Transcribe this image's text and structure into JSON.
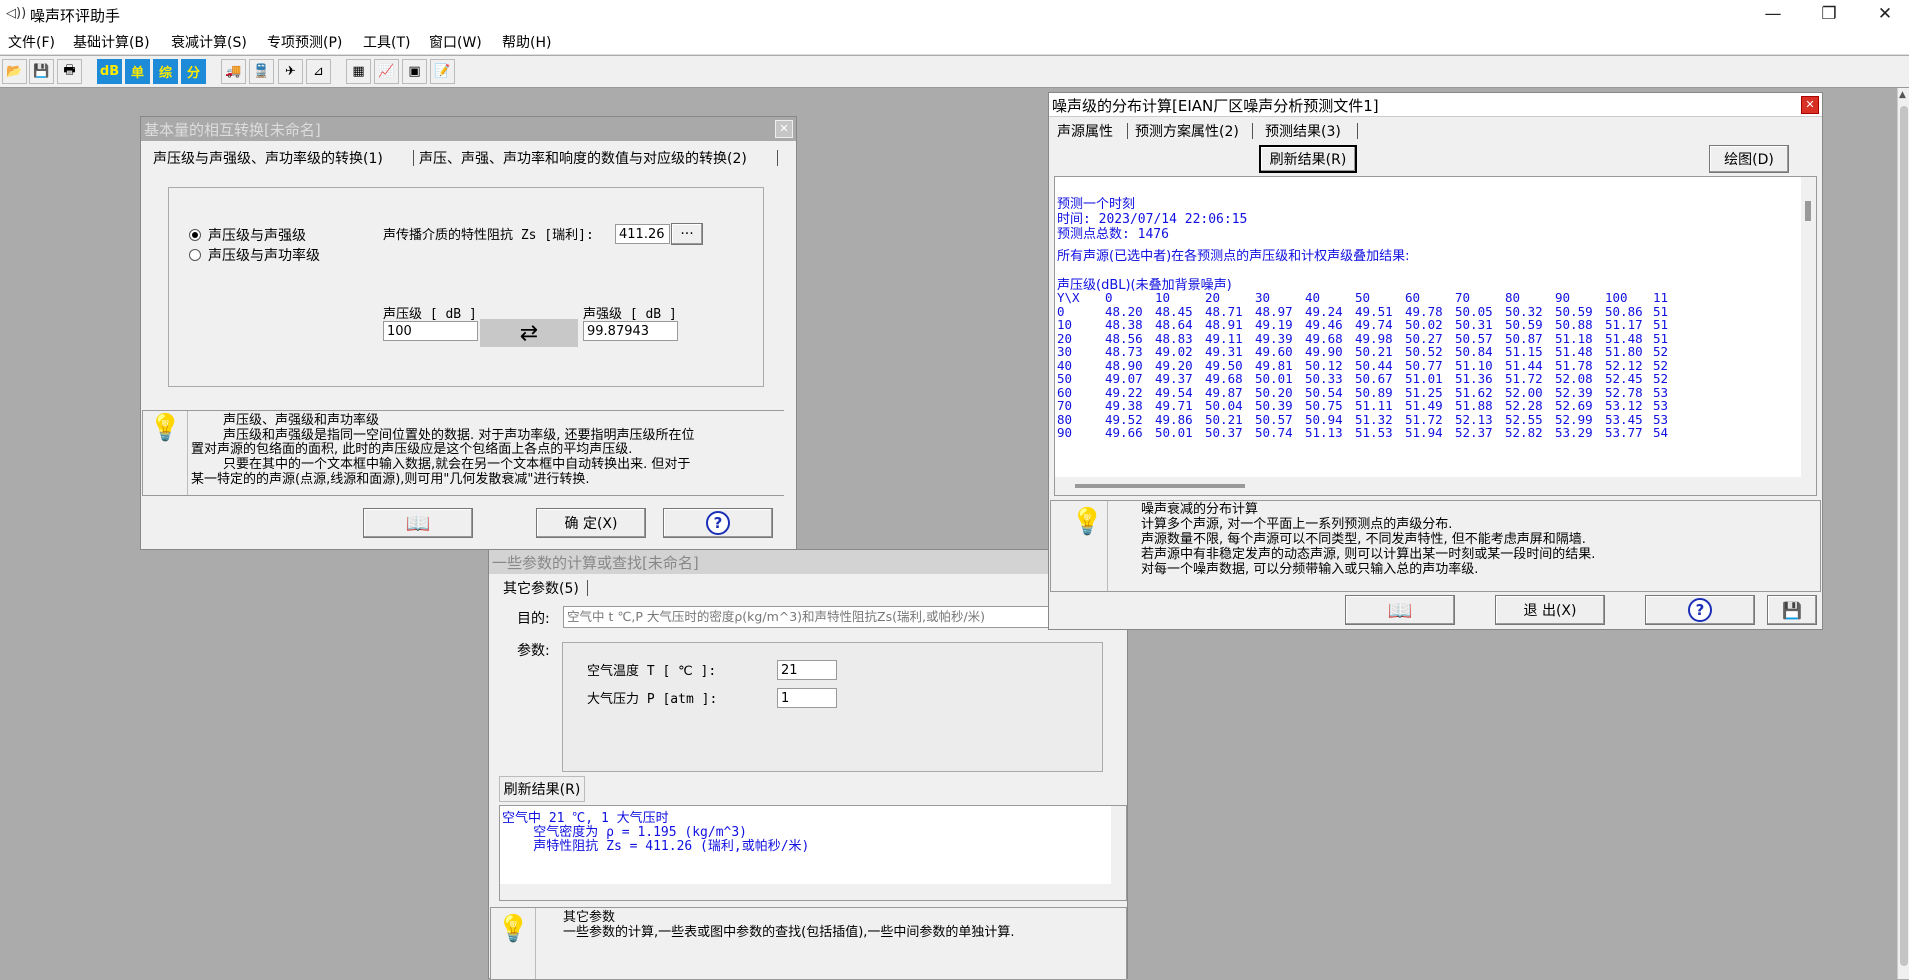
{
  "app": {
    "title": "噪声环评助手",
    "icon": "speaker-icon",
    "minimize": "—",
    "maximize": "❐",
    "close": "✕"
  },
  "menu": [
    "文件(F)",
    "基础计算(B)",
    "衰减计算(S)",
    "专项预测(P)",
    "工具(T)",
    "窗口(W)",
    "帮助(H)"
  ],
  "toolbar": {
    "db": "dB",
    "single": "单",
    "combined": "综",
    "split": "分"
  },
  "dlg1": {
    "title": "基本量的相互转换[未命名]",
    "tab1": "声压级与声强级、声功率级的转换(1)",
    "tab2": "声压、声强、声功率和响度的数值与对应级的转换(2)",
    "radio1": "声压级与声强级",
    "radio2": "声压级与声功率级",
    "impedance_label": "声传播介质的特性阻抗 Zs [瑞利]:",
    "impedance_value": "411.26",
    "impedance_btn": "···",
    "spl_label": "声压级 [ dB ]",
    "spl_value": "100",
    "sil_label": "声强级 [ dB ]",
    "sil_value": "99.87943",
    "help_lines": [
      "声压级、声强级和声功率级",
      "声压级和声强级是指同一空间位置处的数据. 对于声功率级, 还要指明声压级所在位",
      "置对声源的包络面的面积, 此时的声压级应是这个包络面上各点的平均声压级.",
      "只要在其中的一个文本框中输入数据,就会在另一个文本框中自动转换出来. 但对于",
      "某一特定的的声源(点源,线源和面源),则可用\"几何发散衰减\"进行转换."
    ],
    "ok": "确 定(X)"
  },
  "dlg2": {
    "title": "噪声级的分布计算[EIAN厂区噪声分析预测文件1]",
    "tabs": [
      "声源属性",
      "预测方案属性(2)",
      "预测结果(3)"
    ],
    "refresh": "刷新结果(R)",
    "plot": "绘图(D)",
    "res_line1": "预测一个时刻",
    "res_line2": "时间: 2023/07/14 22:06:15",
    "res_line3": "预测点总数: 1476",
    "res_line4": "所有声源(已选中者)在各预测点的声压级和计权声级叠加结果:",
    "res_line5": "声压级(dBL)(未叠加背景噪声)",
    "table_corner": "Y\\X",
    "table_cols": [
      "0",
      "10",
      "20",
      "30",
      "40",
      "50",
      "60",
      "70",
      "80",
      "90",
      "100",
      "11"
    ],
    "table_rows": [
      [
        "0",
        "48.20",
        "48.45",
        "48.71",
        "48.97",
        "49.24",
        "49.51",
        "49.78",
        "50.05",
        "50.32",
        "50.59",
        "50.86",
        "51"
      ],
      [
        "10",
        "48.38",
        "48.64",
        "48.91",
        "49.19",
        "49.46",
        "49.74",
        "50.02",
        "50.31",
        "50.59",
        "50.88",
        "51.17",
        "51"
      ],
      [
        "20",
        "48.56",
        "48.83",
        "49.11",
        "49.39",
        "49.68",
        "49.98",
        "50.27",
        "50.57",
        "50.87",
        "51.18",
        "51.48",
        "51"
      ],
      [
        "30",
        "48.73",
        "49.02",
        "49.31",
        "49.60",
        "49.90",
        "50.21",
        "50.52",
        "50.84",
        "51.15",
        "51.48",
        "51.80",
        "52"
      ],
      [
        "40",
        "48.90",
        "49.20",
        "49.50",
        "49.81",
        "50.12",
        "50.44",
        "50.77",
        "51.10",
        "51.44",
        "51.78",
        "52.12",
        "52"
      ],
      [
        "50",
        "49.07",
        "49.37",
        "49.68",
        "50.01",
        "50.33",
        "50.67",
        "51.01",
        "51.36",
        "51.72",
        "52.08",
        "52.45",
        "52"
      ],
      [
        "60",
        "49.22",
        "49.54",
        "49.87",
        "50.20",
        "50.54",
        "50.89",
        "51.25",
        "51.62",
        "52.00",
        "52.39",
        "52.78",
        "53"
      ],
      [
        "70",
        "49.38",
        "49.71",
        "50.04",
        "50.39",
        "50.75",
        "51.11",
        "51.49",
        "51.88",
        "52.28",
        "52.69",
        "53.12",
        "53"
      ],
      [
        "80",
        "49.52",
        "49.86",
        "50.21",
        "50.57",
        "50.94",
        "51.32",
        "51.72",
        "52.13",
        "52.55",
        "52.99",
        "53.45",
        "53"
      ],
      [
        "90",
        "49.66",
        "50.01",
        "50.37",
        "50.74",
        "51.13",
        "51.53",
        "51.94",
        "52.37",
        "52.82",
        "53.29",
        "53.77",
        "54"
      ]
    ],
    "help_lines": [
      "噪声衰减的分布计算",
      "计算多个声源, 对一个平面上一系列预测点的声级分布.",
      "声源数量不限, 每个声源可以不同类型, 不同发声特性, 但不能考虑声屏和隔墙.",
      "若声源中有非稳定发声的动态声源, 则可以计算出某一时刻或某一段时间的结果.",
      "对每一个噪声数据, 可以分频带输入或只输入总的声功率级."
    ],
    "exit": "退 出(X)"
  },
  "dlg3": {
    "title": "一些参数的计算或查找[未命名]",
    "tab": "其它参数(5)",
    "purpose_label": "目的:",
    "purpose_value": "空气中 t ℃,P 大气压时的密度ρ(kg/m^3)和声特性阻抗Zs(瑞利,或帕秒/米)",
    "params_label": "参数:",
    "temp_label": "空气温度 T [ ℃ ]:",
    "temp_value": "21",
    "press_label": "大气压力 P [atm ]:",
    "press_value": "1",
    "refresh": "刷新结果(R)",
    "result_lines": [
      "空气中 21 ℃, 1 大气压时",
      "    空气密度为 ρ = 1.195 (kg/m^3)",
      "    声特性阻抗 Zs = 411.26 (瑞利,或帕秒/米)"
    ],
    "help_lines": [
      "其它参数",
      "一些参数的计算,一些表或图中参数的查找(包括插值),一些中间参数的单独计算."
    ]
  }
}
